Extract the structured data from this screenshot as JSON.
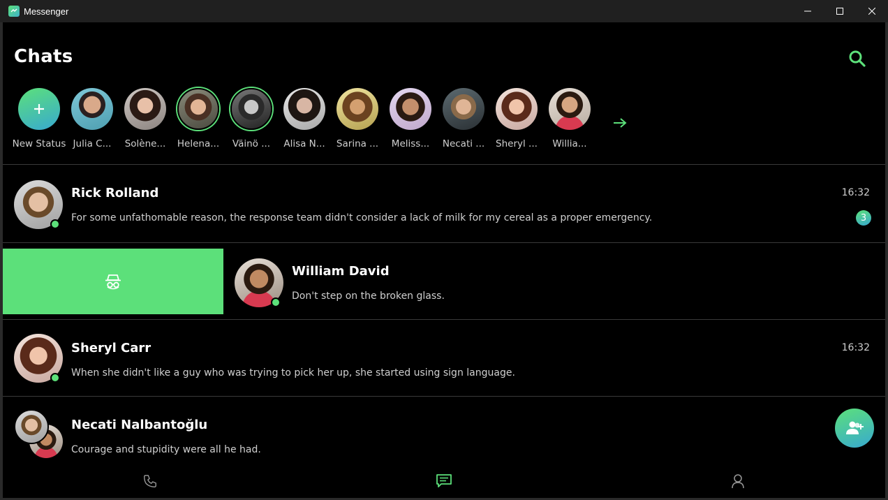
{
  "window": {
    "title": "Messenger"
  },
  "header": {
    "title": "Chats",
    "search_icon": "search-icon"
  },
  "colors": {
    "accent": "#5ce07a",
    "accent_gradient_end": "#38a9d0",
    "background": "#000000",
    "titlebar": "#202020",
    "divider": "#3a3a3a"
  },
  "stories": [
    {
      "name": "New Status",
      "kind": "new"
    },
    {
      "name": "Julia C...",
      "kind": "contact",
      "ring": false
    },
    {
      "name": "Solène...",
      "kind": "contact",
      "ring": false
    },
    {
      "name": "Helena...",
      "kind": "contact",
      "ring": true
    },
    {
      "name": "Väinö ...",
      "kind": "contact",
      "ring": true
    },
    {
      "name": "Alisa N...",
      "kind": "contact",
      "ring": false
    },
    {
      "name": "Sarina ...",
      "kind": "contact",
      "ring": false
    },
    {
      "name": "Meliss...",
      "kind": "contact",
      "ring": false
    },
    {
      "name": "Necati ...",
      "kind": "contact",
      "ring": false
    },
    {
      "name": "Sheryl ...",
      "kind": "contact",
      "ring": false
    },
    {
      "name": "Willia...",
      "kind": "contact",
      "ring": false
    }
  ],
  "chats": [
    {
      "name": "Rick Rolland",
      "message": "For some unfathomable reason, the response team didn't consider a lack of milk for my cereal as a proper emergency.",
      "time": "16:32",
      "unread": "3",
      "online": true
    },
    {
      "name": "William David",
      "message": "Don't step on the broken glass.",
      "time": "",
      "online": true,
      "swipe_action_icon": "incognito-icon"
    },
    {
      "name": "Sheryl Carr",
      "message": "When she didn't like a guy who was trying to pick her up, she started using sign language.",
      "time": "16:32",
      "online": true
    },
    {
      "name": "Necati Nalbantoğlu",
      "message": "Courage and stupidity were all he had.",
      "time": "",
      "online": false,
      "group_avatar": true
    }
  ],
  "fab": {
    "icon": "add-contact-icon"
  },
  "bottom_nav": [
    {
      "icon": "phone-icon",
      "active": false
    },
    {
      "icon": "chat-icon",
      "active": true
    },
    {
      "icon": "profile-icon",
      "active": false
    }
  ]
}
